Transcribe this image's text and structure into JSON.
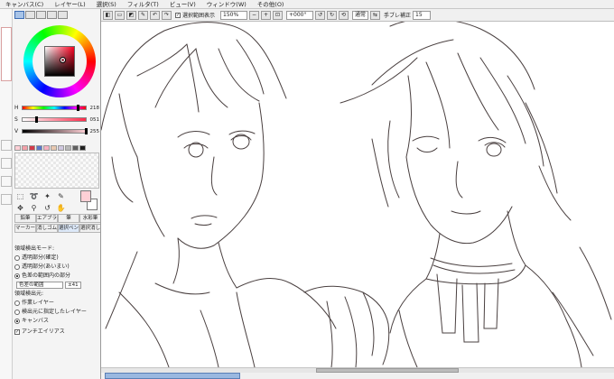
{
  "menubar": {
    "items": [
      "キャンバス(C)",
      "レイヤー(L)",
      "選択(S)",
      "フィルタ(T)",
      "ビュー(V)",
      "ウィンドウ(W)",
      "その他(O)"
    ]
  },
  "toolbar": {
    "selection_show_label": "選択範囲表示",
    "zoom": "150%",
    "angle": "+000°",
    "blend_mode": "通常",
    "stabilizer_label": "手ブレ補正",
    "stabilizer_value": "15"
  },
  "color_sliders": [
    {
      "label": "H",
      "value": "218"
    },
    {
      "label": "S",
      "value": "051"
    },
    {
      "label": "V",
      "value": "255"
    }
  ],
  "brush_tabs": [
    "鉛筆",
    "エアブラシ",
    "筆",
    "水彩筆",
    "マーカー",
    "消しゴム",
    "選択ペン",
    "選択消し"
  ],
  "select_tool": {
    "mode_heading": "領域検出モード:",
    "mode_options": [
      "透明部分(確定)",
      "透明部分(あいまい)",
      "色差の範囲内の部分"
    ],
    "color_range_label": "色差の範囲",
    "color_range_value": "±41",
    "source_heading": "領域検出元:",
    "source_options": [
      "作業レイヤー",
      "検出元に指定したレイヤー",
      "キャンバス"
    ],
    "antialias_label": "アンチエイリアス"
  },
  "colors": {
    "foreground": "#ffd0d6",
    "background": "#ffffff",
    "accent": "#3b6bb2"
  }
}
